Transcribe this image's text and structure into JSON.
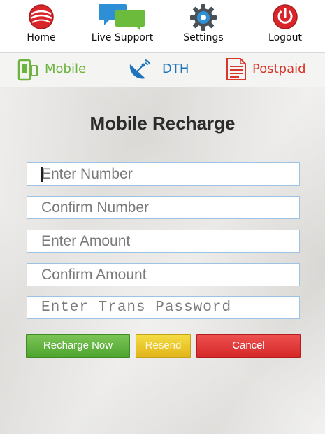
{
  "nav": {
    "items": [
      {
        "label": "Home",
        "icon": "home-logo-icon"
      },
      {
        "label": "Live Support",
        "icon": "chat-bubbles-icon"
      },
      {
        "label": "Settings",
        "icon": "gear-icon"
      },
      {
        "label": "Logout",
        "icon": "power-icon"
      }
    ]
  },
  "tabs": {
    "items": [
      {
        "label": "Mobile",
        "icon": "mobile-phone-icon",
        "color": "#6cb33f"
      },
      {
        "label": "DTH",
        "icon": "satellite-dish-icon",
        "color": "#1d74b8"
      },
      {
        "label": "Postpaid",
        "icon": "bill-icon",
        "color": "#d9372d"
      }
    ]
  },
  "form": {
    "title": "Mobile Recharge",
    "fields": {
      "number": {
        "placeholder": "Enter Number"
      },
      "confirm_number": {
        "placeholder": "Confirm Number"
      },
      "amount": {
        "placeholder": "Enter Amount"
      },
      "confirm_amount": {
        "placeholder": "Confirm Amount"
      },
      "password": {
        "placeholder": "Enter Trans Password"
      }
    },
    "buttons": {
      "recharge": "Recharge Now",
      "resend": "Resend",
      "cancel": "Cancel"
    }
  },
  "colors": {
    "recharge": "#5cb039",
    "resend": "#ecc82d",
    "cancel": "#e23a3a",
    "field_border": "#9cc3e4"
  }
}
